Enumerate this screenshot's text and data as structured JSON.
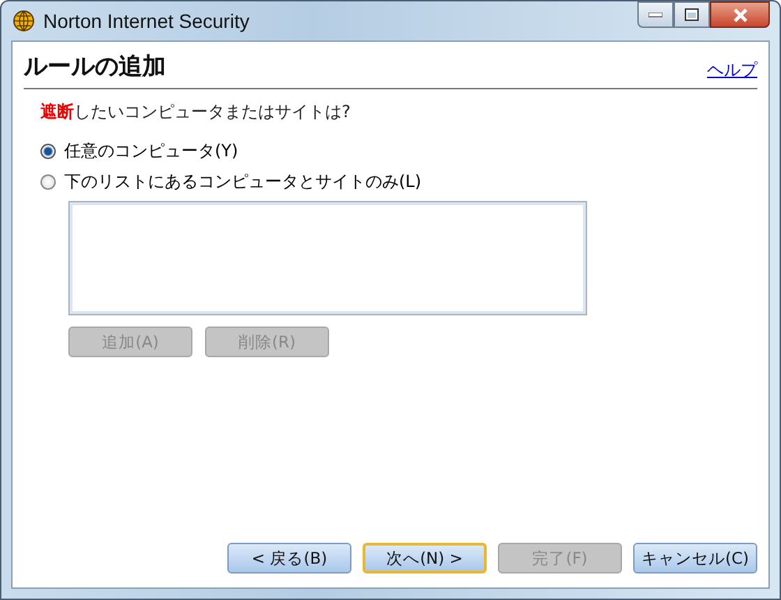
{
  "window": {
    "title": "Norton Internet Security"
  },
  "page": {
    "title": "ルールの追加",
    "help_link": "ヘルプ"
  },
  "question": "**遮断**したいコンピュータまたはサイトは?",
  "options": [
    {
      "label": "任意のコンピュータ(Y)",
      "selected": true
    },
    {
      "label": "下のリストにあるコンピュータとサイトのみ(L)",
      "selected": false
    }
  ],
  "list_buttons": [
    {
      "label": "追加(A)",
      "disabled": true
    },
    {
      "label": "削除(R)",
      "disabled": true
    }
  ],
  "buttons": [
    {
      "label": "< 戻る(B)",
      "disabled": false,
      "default": false
    },
    {
      "label": "次へ(N) >",
      "disabled": false,
      "default": true
    },
    {
      "label": "完了(F)",
      "disabled": true,
      "default": false
    },
    {
      "label": "キャンセル(C)",
      "disabled": false,
      "default": false
    }
  ]
}
